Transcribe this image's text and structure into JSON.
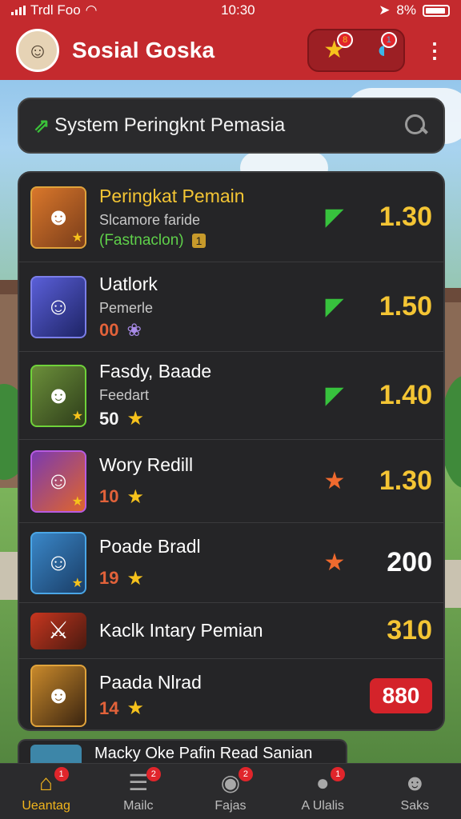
{
  "status_bar": {
    "carrier": "Trdl Foo",
    "time": "10:30",
    "battery": "8%"
  },
  "header": {
    "title": "Sosial Goska",
    "badges": {
      "star": "8",
      "bird": "1"
    }
  },
  "search": {
    "text": "System Peringknt Pemasia"
  },
  "players": [
    {
      "name": "Peringkat Pemain",
      "sub": "Slcamore faride",
      "meta_text": "(Fastnaclon)",
      "meta_tag": "1",
      "trend": "up",
      "score": "1.30"
    },
    {
      "name": "Uatlork",
      "sub": "Pemerle",
      "meta_num": "00",
      "trend": "up",
      "score": "1.50"
    },
    {
      "name": "Fasdy, Baade",
      "sub": "Feedart",
      "meta_num": "50",
      "trend": "up",
      "score": "1.40"
    },
    {
      "name": "Wory Redill",
      "meta_num": "10",
      "trend": "star",
      "score": "1.30"
    },
    {
      "name": "Poade Bradl",
      "meta_num": "19",
      "trend": "star",
      "score": "200"
    },
    {
      "name": "Kaclk Intary Pemian",
      "score": "310"
    },
    {
      "name": "Paada Nlrad",
      "meta_num": "14",
      "score": "880"
    }
  ],
  "peek_row": {
    "name": "Macky Oke Pafin Read Sanian"
  },
  "bottom_nav": [
    {
      "label": "Ueantag",
      "icon": "home-icon",
      "badge": "1"
    },
    {
      "label": "Mailc",
      "icon": "mail-icon",
      "badge": "2"
    },
    {
      "label": "Fajas",
      "icon": "gamepad-icon",
      "badge": "2"
    },
    {
      "label": "A Ulalis",
      "icon": "chat-icon",
      "badge": "1"
    },
    {
      "label": "Saks",
      "icon": "person-icon",
      "badge": ""
    }
  ],
  "colors": {
    "brand_red": "#c42a2e",
    "gold": "#f4c534",
    "green": "#37c23d",
    "panel": "#252527"
  }
}
